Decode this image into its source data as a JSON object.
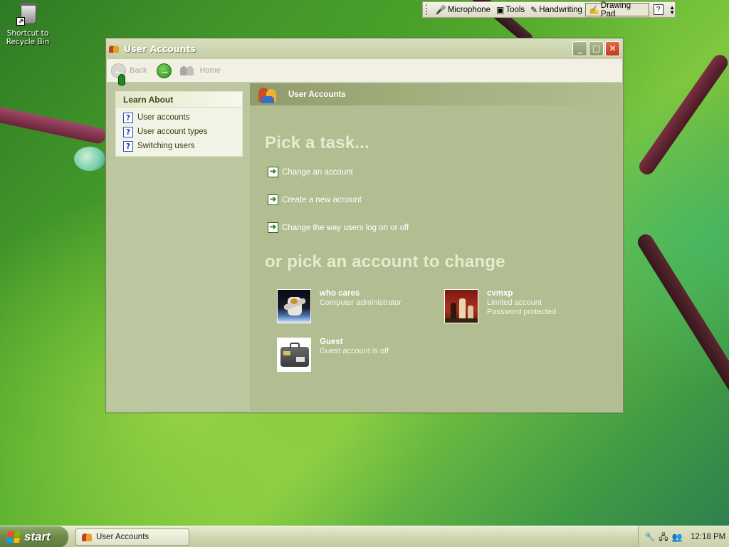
{
  "desktop": {
    "icon_label": "Shortcut to Recycle Bin"
  },
  "language_bar": {
    "items": [
      "Microphone",
      "Tools",
      "Handwriting",
      "Drawing Pad"
    ],
    "help": "?"
  },
  "window": {
    "title": "User Accounts",
    "toolbar": {
      "back_label": "Back",
      "home_label": "Home"
    },
    "learn_about": {
      "title": "Learn About",
      "items": [
        "User accounts",
        "User account types",
        "Switching users"
      ]
    },
    "header_title": "User Accounts",
    "pick_task_heading": "Pick a task...",
    "tasks": [
      "Change an account",
      "Create a new account",
      "Change the way users log on or off"
    ],
    "pick_account_heading": "or pick an account to change",
    "accounts": [
      {
        "name": "who cares",
        "lines": [
          "Computer administrator"
        ]
      },
      {
        "name": "cvmxp",
        "lines": [
          "Limited account",
          "Password protected"
        ]
      },
      {
        "name": "Guest",
        "lines": [
          "Guest account is off"
        ]
      }
    ]
  },
  "taskbar": {
    "start_label": "start",
    "window_button": "User Accounts",
    "clock": "12:18 PM"
  },
  "colors": {
    "window_bg": "#b8c39a",
    "heading": "#e6ebcf",
    "accent_green": "#2b8a1c"
  }
}
